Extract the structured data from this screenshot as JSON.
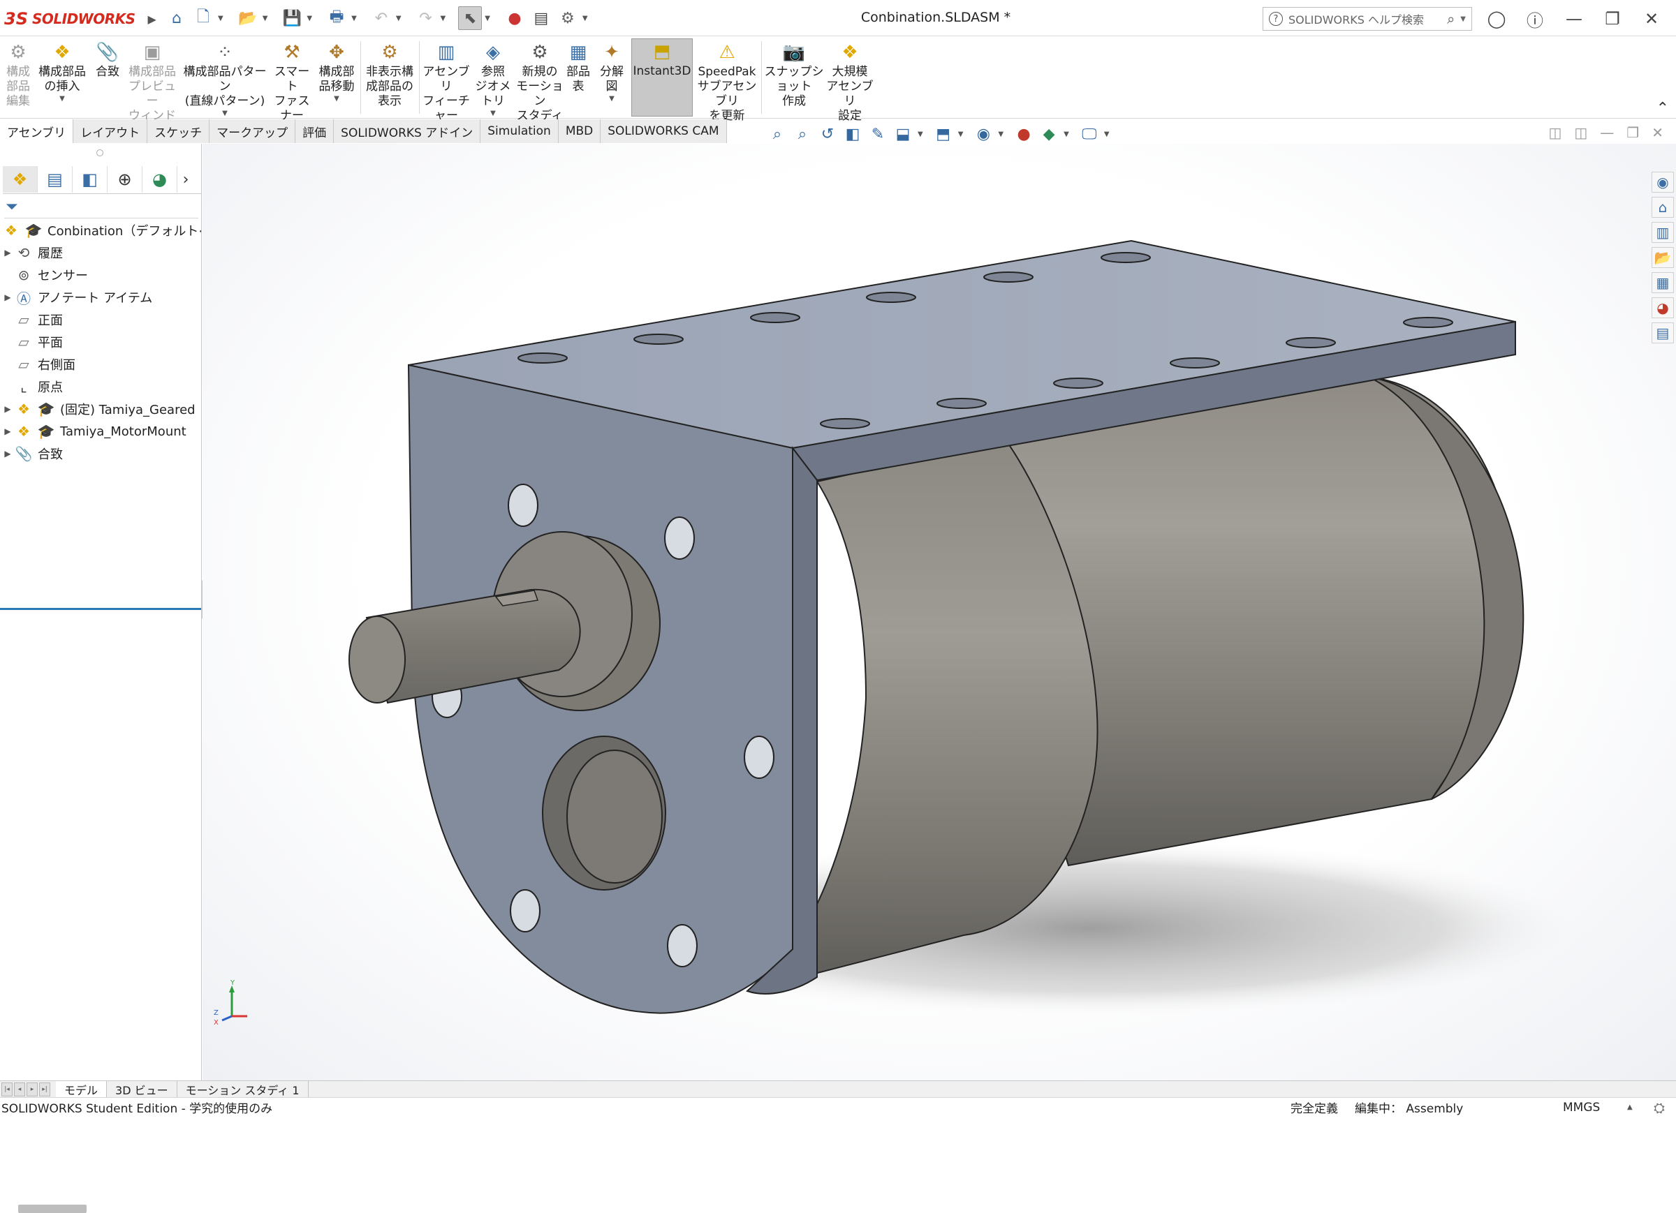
{
  "app": {
    "logo_ds": "3S",
    "logo_name": "SOLIDWORKS",
    "doc_title": "Conbination.SLDASM *"
  },
  "help_search": {
    "placeholder": "SOLIDWORKS ヘルプ検索"
  },
  "ribbon": {
    "edit_component": "構成\n部品\n編集",
    "insert_components": "構成部品\nの挿入",
    "mate": "合致",
    "preview_window": "構成部品\nプレビュー\nウィンドウ",
    "linear_pattern": "構成部品パターン\n(直線パターン)",
    "smart_fasteners": "スマート\nファスナー",
    "move_component": "構成部\n品移動",
    "show_hidden": "非表示構\n成部品の\n表示",
    "assembly_features": "アセンブリ\nフィーチャー",
    "reference_geometry": "参照\nジオメトリ",
    "new_motion_study": "新規の\nモーション\nスタディ",
    "bom": "部品\n表",
    "exploded_view": "分解\n図",
    "instant3d": "Instant3D",
    "speedpak": "SpeedPak\nサブアセンブリ\nを更新",
    "snapshot": "スナップショット\n作成",
    "large_assembly": "大規模\nアセンブリ\n設定"
  },
  "command_tabs": [
    "アセンブリ",
    "レイアウト",
    "スケッチ",
    "マークアップ",
    "評価",
    "SOLIDWORKS アドイン",
    "Simulation",
    "MBD",
    "SOLIDWORKS CAM"
  ],
  "tree": {
    "root": "Conbination（デフォルト<表",
    "history": "履歴",
    "sensors": "センサー",
    "annotations": "アノテート アイテム",
    "front_plane": "正面",
    "top_plane": "平面",
    "right_plane": "右側面",
    "origin": "原点",
    "part1": "(固定) Tamiya_Geared",
    "part2": "Tamiya_MotorMount",
    "mates": "合致"
  },
  "bottom_tabs": [
    "モデル",
    "3D ビュー",
    "モーション スタディ 1"
  ],
  "status": {
    "edition": "SOLIDWORKS Student Edition - 学究的使用のみ",
    "definition": "完全定義",
    "editing": "編集中： Assembly",
    "units": "MMGS"
  },
  "triad": {
    "y": "Y",
    "z": "Z",
    "x": "X"
  },
  "colors": {
    "accent": "#3a6ea5",
    "brand_red": "#d52b1e",
    "model_plate": "#8f98a8",
    "model_motor": "#8a8780"
  }
}
